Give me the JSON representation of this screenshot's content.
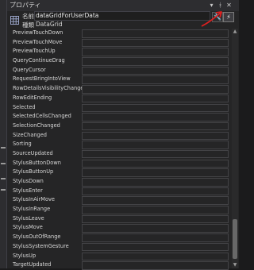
{
  "window": {
    "title": "プロパティ",
    "buttons": {
      "dropdown": "▾",
      "pin": "ᚼ",
      "close": "✕"
    }
  },
  "selection": {
    "name_key": "名前",
    "name_value": "dataGridForUserData",
    "type_key": "種類",
    "type_value": "DataGrid"
  },
  "toolbar": {
    "properties_icon": "wrench-icon",
    "events_icon": "lightning-bolt-icon",
    "annotation_color": "#e02020"
  },
  "events": [
    {
      "name": "PreviewTouchDown",
      "value": ""
    },
    {
      "name": "PreviewTouchMove",
      "value": ""
    },
    {
      "name": "PreviewTouchUp",
      "value": ""
    },
    {
      "name": "QueryContinueDrag",
      "value": ""
    },
    {
      "name": "QueryCursor",
      "value": ""
    },
    {
      "name": "RequestBringIntoView",
      "value": ""
    },
    {
      "name": "RowDetailsVisibilityChanged",
      "value": ""
    },
    {
      "name": "RowEditEnding",
      "value": ""
    },
    {
      "name": "Selected",
      "value": ""
    },
    {
      "name": "SelectedCellsChanged",
      "value": ""
    },
    {
      "name": "SelectionChanged",
      "value": ""
    },
    {
      "name": "SizeChanged",
      "value": ""
    },
    {
      "name": "Sorting",
      "value": ""
    },
    {
      "name": "SourceUpdated",
      "value": ""
    },
    {
      "name": "StylusButtonDown",
      "value": ""
    },
    {
      "name": "StylusButtonUp",
      "value": ""
    },
    {
      "name": "StylusDown",
      "value": ""
    },
    {
      "name": "StylusEnter",
      "value": ""
    },
    {
      "name": "StylusInAirMove",
      "value": ""
    },
    {
      "name": "StylusInRange",
      "value": ""
    },
    {
      "name": "StylusLeave",
      "value": ""
    },
    {
      "name": "StylusMove",
      "value": ""
    },
    {
      "name": "StylusOutOfRange",
      "value": ""
    },
    {
      "name": "StylusSystemGesture",
      "value": ""
    },
    {
      "name": "StylusUp",
      "value": ""
    },
    {
      "name": "TargetUpdated",
      "value": ""
    }
  ]
}
